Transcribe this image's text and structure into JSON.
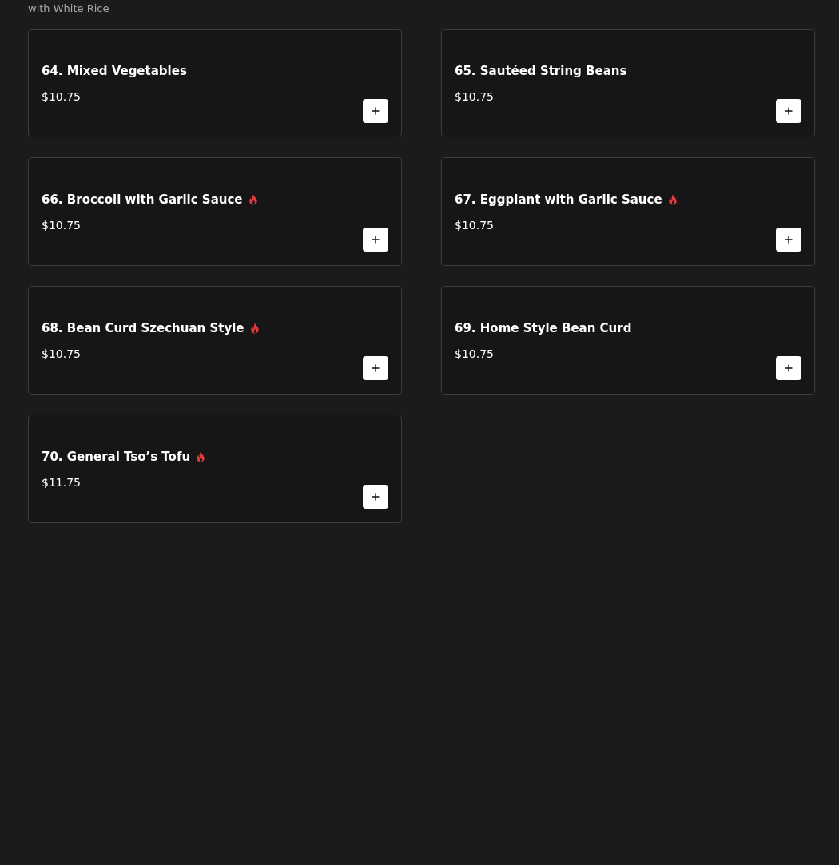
{
  "section_note": "with White Rice",
  "items": [
    {
      "name": "64. Mixed Vegetables",
      "price": "$10.75",
      "spicy": false
    },
    {
      "name": "65. Sautéed String Beans",
      "price": "$10.75",
      "spicy": false
    },
    {
      "name": "66. Broccoli with Garlic Sauce",
      "price": "$10.75",
      "spicy": true
    },
    {
      "name": "67. Eggplant with Garlic Sauce",
      "price": "$10.75",
      "spicy": true
    },
    {
      "name": "68. Bean Curd Szechuan Style",
      "price": "$10.75",
      "spicy": true
    },
    {
      "name": "69. Home Style Bean Curd",
      "price": "$10.75",
      "spicy": false
    },
    {
      "name": "70. General Tso’s Tofu",
      "price": "$11.75",
      "spicy": true
    }
  ]
}
